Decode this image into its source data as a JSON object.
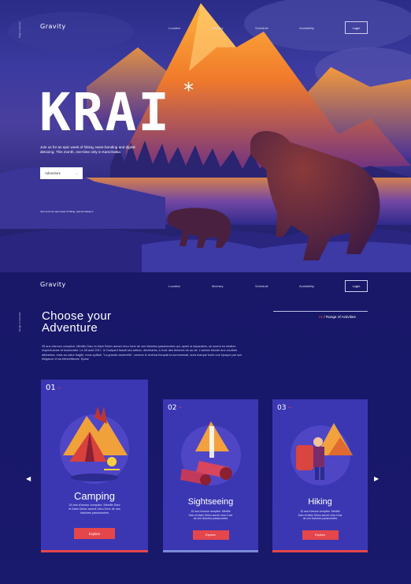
{
  "hero": {
    "brand": "Gravity",
    "nav": [
      "Location",
      "Itinerary",
      "Schedule",
      "Availability"
    ],
    "login": "Login",
    "side_label": "Page is Gravity",
    "title": "KRAI",
    "title_mark": "*",
    "description": "Join us for an epic week of hiking, team-bonding and digital detoxing. This month, one-time only in Kamchatka",
    "cta": "Adventure",
    "cta_arrow": "→",
    "caption": "Join us for an epic week of hiking, team-bonding in"
  },
  "section": {
    "brand": "Gravity",
    "nav": [
      "Location",
      "Itinerary",
      "Schedule",
      "Availability"
    ],
    "login": "Login",
    "side_label": "Range of Activities",
    "title_line1": "Choose your",
    "title_line2": "Adventure",
    "range_num": "01",
    "range_label": " / Range of Activities",
    "body": "25 ans d'amour complice. Mireille Darc et Alain Delon auront vécu l'une de ces histoires passionnées qui, après la séparation, se muent en relation respectueuse et fusionnelle. Le 28 août 2017, le Guépard faisait ses adieux, déchirants, à l'une des femmes de sa vie. L'actrice blonde aux courbes affolantes, mais au cœur fragile, nous quittait. \"La grande sauterelle\", comme le cinéma français la surnommait, aura marqué toute une époque par son élégance et sa bienveillance. Epaul"
  },
  "cards": [
    {
      "num": "01",
      "title": "Camping",
      "desc": "15 ans d'amour complice. Mireille Darc et Alain Delon auront vécu l'une de ces histoires passionnées",
      "button": "Explore"
    },
    {
      "num": "02",
      "title": "Sightseeing",
      "desc": "15 ans d'amour complice. Mireille Darc et Alain Delon auront vécu l'une de ces histoires passionnées",
      "button": "Explore"
    },
    {
      "num": "03",
      "title": "Hiking",
      "desc": "15 ans d'amour complice. Mireille Darc et Alain Delon auront vécu l'une de ces histoires passionnées",
      "button": "Explore"
    }
  ],
  "carousel": {
    "prev": "◀",
    "next": "▶"
  },
  "colors": {
    "accent": "#e5464b",
    "card_bg": "#3b37b3",
    "page_bg": "#181768"
  },
  "icons": [
    "left-arrow-icon",
    "right-arrow-icon"
  ]
}
